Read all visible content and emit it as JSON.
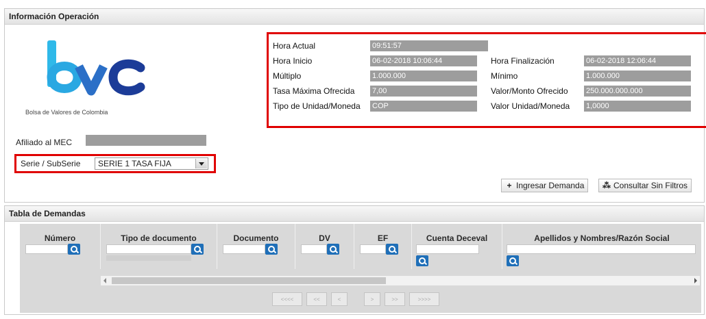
{
  "panel_info": {
    "title": "Información Operación",
    "logo_text": "bvc",
    "logo_caption": "Bolsa de Valores de Colombia",
    "afiliado_label": "Afiliado al MEC",
    "serie_label": "Serie / SubSerie",
    "serie_value": "SERIE 1 TASA FIJA",
    "fields": {
      "hora_actual_label": "Hora Actual",
      "hora_actual_value": "09:51:57",
      "hora_inicio_label": "Hora Inicio",
      "hora_inicio_value": "06-02-2018 10:06:44",
      "hora_fin_label": "Hora Finalización",
      "hora_fin_value": "06-02-2018 12:06:44",
      "multiplo_label": "Múltiplo",
      "multiplo_value": "1.000.000",
      "minimo_label": "Mínimo",
      "minimo_value": "1.000.000",
      "tasa_label": "Tasa Máxima Ofrecida",
      "tasa_value": "7,00",
      "valor_monto_label": "Valor/Monto Ofrecido",
      "valor_monto_value": "250.000.000.000",
      "tipo_unidad_label": "Tipo de Unidad/Moneda",
      "tipo_unidad_value": "COP",
      "valor_unidad_label": "Valor Unidad/Moneda",
      "valor_unidad_value": "1,0000"
    },
    "buttons": {
      "ingresar": "Ingresar Demanda",
      "consultar": "Consultar Sin Filtros"
    }
  },
  "panel_demandas": {
    "title": "Tabla de Demandas",
    "columns": [
      "Número",
      "Tipo de documento",
      "Documento",
      "DV",
      "EF",
      "Cuenta Deceval",
      "Apellidos y Nombres/Razón Social"
    ],
    "pager": [
      "<<<<",
      "<<",
      "<",
      ">",
      ">>",
      ">>>>"
    ]
  },
  "colors": {
    "highlight": "#e00000",
    "search_button": "#1f6fb8",
    "value_box": "#9d9d9d"
  }
}
